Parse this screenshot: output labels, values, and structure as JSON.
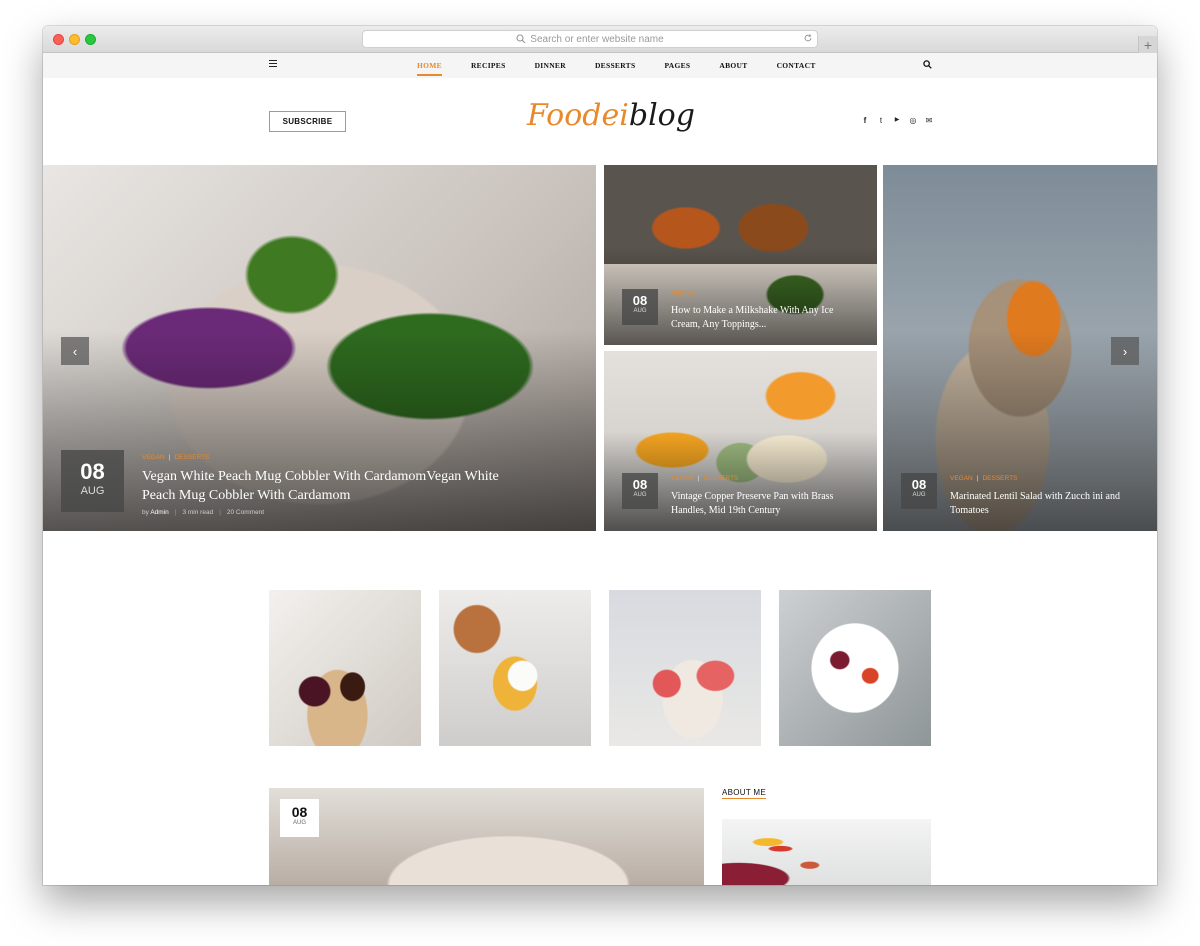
{
  "browser": {
    "url_placeholder": "Search or enter website name"
  },
  "nav": {
    "items": [
      "HOME",
      "RECIPES",
      "DINNER",
      "DESSERTS",
      "PAGES",
      "ABOUT",
      "CONTACT"
    ],
    "active": "HOME"
  },
  "header": {
    "subscribe_label": "SUBSCRIBE",
    "logo_part1": "Foodei",
    "logo_part2": "blog",
    "social": [
      "f",
      "t",
      "▶",
      "◎",
      "✉"
    ]
  },
  "hero": {
    "main": {
      "day": "08",
      "month": "AUG",
      "cat1": "VEGAN",
      "cat2": "DESSERTS",
      "title": "Vegan White Peach Mug Cobbler With CardamomVegan White Peach Mug Cobbler With Cardamom",
      "author_prefix": "by",
      "author": "Admin",
      "read_time": "3 min read",
      "comments": "20 Comment"
    },
    "side1": {
      "day": "08",
      "month": "AUG",
      "cat1": "VEGAN",
      "title": "How to Make a Milkshake With Any Ice Cream, Any Toppings..."
    },
    "side2": {
      "day": "08",
      "month": "AUG",
      "cat1": "VEGAN",
      "cat2": "DESSERTS",
      "title": "Vintage Copper Preserve Pan with Brass Handles, Mid 19th Century"
    },
    "side3": {
      "day": "08",
      "month": "AUG",
      "cat1": "VEGAN",
      "cat2": "DESSERTS",
      "title": "Marinated Lentil Salad with Zucch ini and Tomatoes"
    },
    "prev_arrow": "‹",
    "next_arrow": "›"
  },
  "featured": {
    "day": "08",
    "month": "AUG"
  },
  "sidebar": {
    "about_title": "ABOUT ME"
  },
  "colors": {
    "accent": "#e8892b",
    "nav_bg": "#f5f5f5"
  }
}
